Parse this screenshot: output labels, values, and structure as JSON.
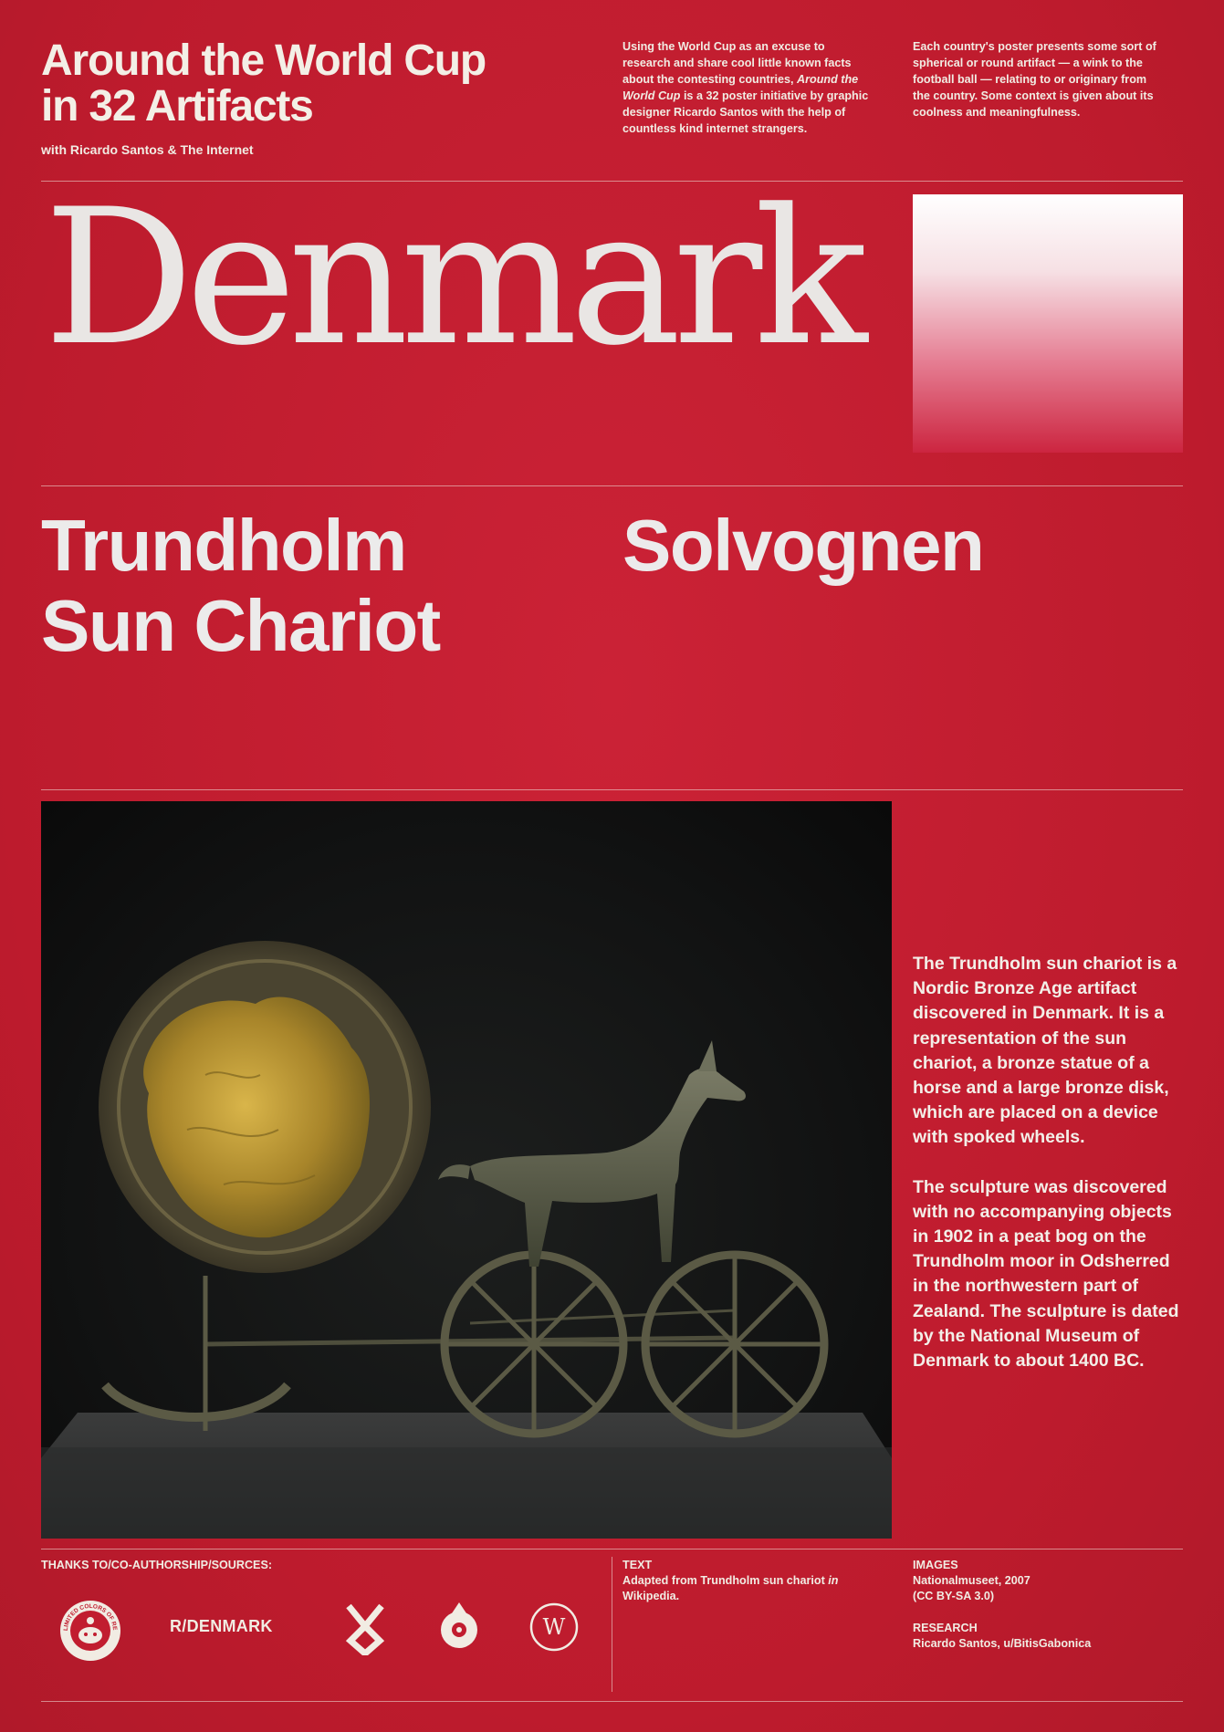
{
  "header": {
    "series_title_line1": "Around the World Cup",
    "series_title_line2": "in 32 Artifacts",
    "series_subtitle": "with Ricardo Santos & The Internet",
    "intro_left": {
      "part1": "Using the World Cup as an excuse to research and share cool little known facts about the contesting countries,",
      "italic": "Around the World Cup",
      "part2": "is a 32 poster initiative by graphic designer Ricardo Santos with the help of countless kind internet strangers."
    },
    "intro_right": "Each country's poster presents some sort of spherical or round artifact — a wink to the football ball — relating to or originary from the country. Some context is given about its coolness and meaningfulness."
  },
  "country": {
    "name": "Denmark",
    "flag_colors": [
      "#ffffff",
      "#c8102e"
    ]
  },
  "artifact": {
    "name_en_line1": "Trundholm",
    "name_en_line2": "Sun Chariot",
    "name_local": "Solvognen"
  },
  "photo": {
    "background": "#121313",
    "disk_gold": "#b8952f",
    "bronze": "#5a5a43"
  },
  "description": {
    "paragraph1": "The Trundholm sun chariot is a Nordic Bronze Age artifact discovered in Denmark. It is a representation of the sun chariot, a bronze statue of a horse and a large bronze disk, which are placed on a device with spoked wheels.",
    "paragraph2": "The sculpture was discovered with no accompanying objects in 1902 in a peat bog on the Trundholm moor in Odsherred in the northwestern part of Zealand. The sculpture is dated by the National Museum of Denmark to about 1400 BC."
  },
  "footer": {
    "thanks_label": "THANKS TO/CO-AUTHORSHIP/SOURCES:",
    "credit_subreddit": "R/DENMARK",
    "text_label": "TEXT",
    "text_value_part1": "Adapted from Trundholm sun chariot",
    "text_value_italic": "in",
    "text_value_part2": "Wikipedia.",
    "images_label": "IMAGES",
    "images_value_line1": "Nationalmuseet, 2007",
    "images_value_line2": "(CC BY-SA 3.0)",
    "research_label": "RESEARCH",
    "research_value": "Ricardo Santos, u/BitisGabonica",
    "icons": [
      "reddit-badge-icon",
      "othala-rune-icon",
      "wikimedia-commons-icon",
      "wikipedia-icon"
    ],
    "badge_text": "LIMITED COLORS OF REDDIT"
  }
}
